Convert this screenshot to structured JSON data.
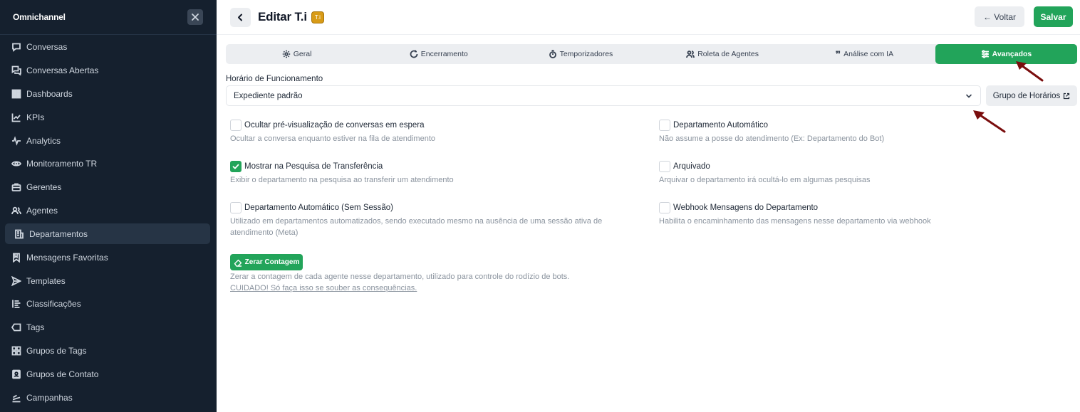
{
  "sidebar": {
    "brand": "Omnichannel",
    "items": [
      {
        "label": "Conversas",
        "icon": "chat-bubble-icon"
      },
      {
        "label": "Conversas Abertas",
        "icon": "chat-multiple-icon"
      },
      {
        "label": "Dashboards",
        "icon": "dashboard-icon"
      },
      {
        "label": "KPIs",
        "icon": "line-chart-icon"
      },
      {
        "label": "Analytics",
        "icon": "pulse-icon"
      },
      {
        "label": "Monitoramento TR",
        "icon": "eye-icon"
      },
      {
        "label": "Gerentes",
        "icon": "briefcase-icon"
      },
      {
        "label": "Agentes",
        "icon": "users-icon"
      },
      {
        "label": "Departamentos",
        "icon": "building-icon"
      },
      {
        "label": "Mensagens Favoritas",
        "icon": "bookmark-icon"
      },
      {
        "label": "Templates",
        "icon": "send-icon"
      },
      {
        "label": "Classificações",
        "icon": "list-icon"
      },
      {
        "label": "Tags",
        "icon": "tag-icon"
      },
      {
        "label": "Grupos de Tags",
        "icon": "grid-icon"
      },
      {
        "label": "Grupos de Contato",
        "icon": "contacts-icon"
      },
      {
        "label": "Campanhas",
        "icon": "megaphone-icon"
      }
    ],
    "active_index": 8
  },
  "header": {
    "title": "Editar T.i",
    "badge": "T.i",
    "back_label": "← Voltar",
    "save_label": "Salvar"
  },
  "tabs": [
    {
      "label": "Geral",
      "icon": "gear-icon"
    },
    {
      "label": "Encerramento",
      "icon": "refresh-icon"
    },
    {
      "label": "Temporizadores",
      "icon": "timer-icon"
    },
    {
      "label": "Roleta de Agentes",
      "icon": "users-icon"
    },
    {
      "label": "Análise com IA",
      "icon": "quote-icon"
    },
    {
      "label": "Avançados",
      "icon": "sliders-icon"
    }
  ],
  "active_tab": 5,
  "hours": {
    "label": "Horário de Funcionamento",
    "value": "Expediente padrão",
    "group_button": "Grupo de Horários"
  },
  "options": [
    {
      "title": "Ocultar pré-visualização de conversas em espera",
      "desc": "Ocultar a conversa enquanto estiver na fila de atendimento",
      "checked": false
    },
    {
      "title": "Departamento Automático",
      "desc": "Não assume a posse do atendimento (Ex: Departamento do Bot)",
      "checked": false
    },
    {
      "title": "Mostrar na Pesquisa de Transferência",
      "desc": "Exibir o departamento na pesquisa ao transferir um atendimento",
      "checked": true
    },
    {
      "title": "Arquivado",
      "desc": "Arquivar o departamento irá ocultá-lo em algumas pesquisas",
      "checked": false
    },
    {
      "title": "Departamento Automático (Sem Sessão)",
      "desc": "Utilizado em departamentos automatizados, sendo executado mesmo na ausência de uma sessão ativa de atendimento (Meta)",
      "checked": false
    },
    {
      "title": "Webhook Mensagens do Departamento",
      "desc": "Habilita o encaminhamento das mensagens nesse departamento via webhook",
      "checked": false
    }
  ],
  "reset": {
    "button": "Zerar Contagem",
    "desc": "Zerar a contagem de cada agente nesse departamento, utilizado para controle do rodízio de bots.",
    "warning": "CUIDADO! Só faça isso se souber as consequências."
  },
  "colors": {
    "sidebar_bg": "#15202e",
    "accent_green": "#22a45a",
    "annotation_arrow": "#7a0d0d"
  }
}
